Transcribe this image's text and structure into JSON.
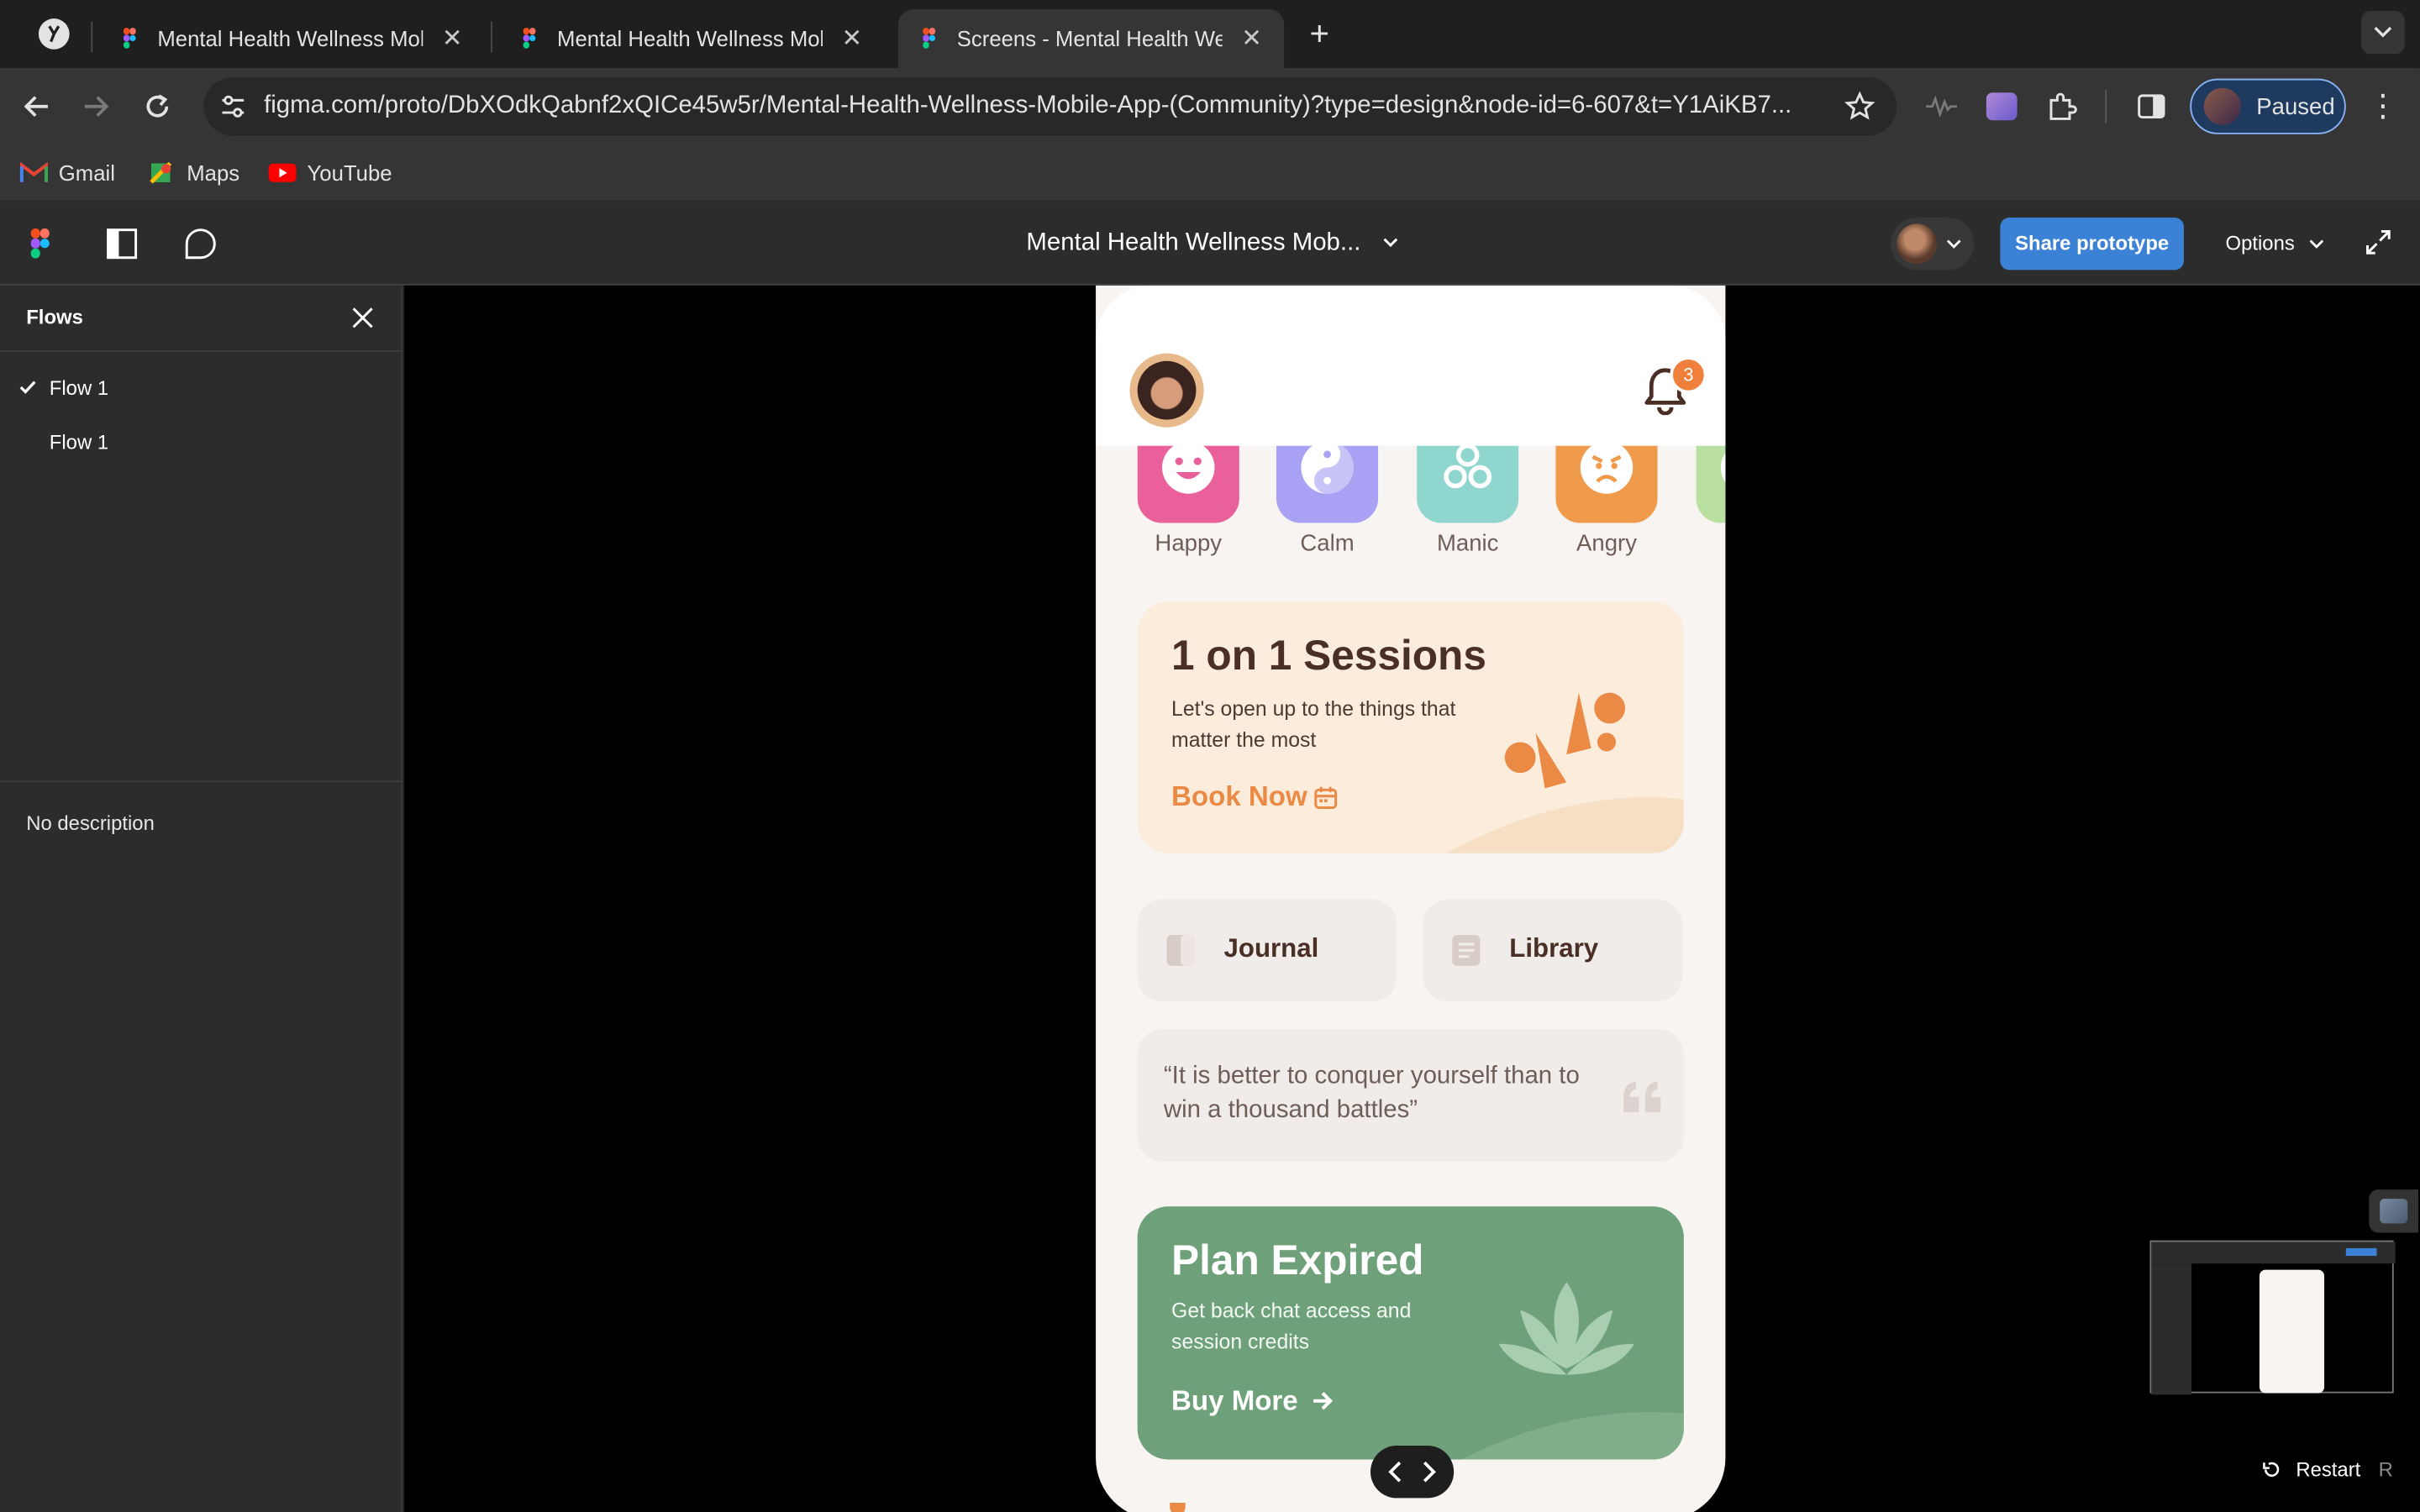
{
  "browser": {
    "tabs": [
      {
        "title": "Mental Health Wellness Mobile App (Community)",
        "active": false
      },
      {
        "title": "Mental Health Wellness Mobile App (Community)",
        "active": false
      },
      {
        "title": "Screens - Mental Health Wellness",
        "active": true
      }
    ],
    "url": "figma.com/proto/DbXOdkQabnf2xQICe45w5r/Mental-Health-Wellness-Mobile-App-(Community)?type=design&node-id=6-607&t=Y1AiKB7...",
    "profile_label": "Paused",
    "bookmarks": [
      "Gmail",
      "Maps",
      "YouTube"
    ]
  },
  "figma": {
    "file_title": "Mental Health Wellness Mob...",
    "share_label": "Share prototype",
    "options_label": "Options",
    "restart_label": "Restart",
    "restart_shortcut": "R"
  },
  "sidebar": {
    "title": "Flows",
    "flows": [
      {
        "label": "Flow 1",
        "selected": true
      },
      {
        "label": "Flow 1",
        "selected": false
      }
    ],
    "description": "No description"
  },
  "app": {
    "notification_count": "3",
    "moods": [
      {
        "label": "Happy",
        "color": "#e9609a",
        "icon": "smile-icon"
      },
      {
        "label": "Calm",
        "color": "#a9a2f4",
        "icon": "yin-yang-icon"
      },
      {
        "label": "Manic",
        "color": "#8fd6cf",
        "icon": "triskelion-icon"
      },
      {
        "label": "Angry",
        "color": "#f09a4c",
        "icon": "angry-face-icon"
      },
      {
        "label": "",
        "color": "#b9e0a0",
        "icon": "partial-mood-icon"
      }
    ],
    "sessions": {
      "title": "1 on 1 Sessions",
      "subtitle": "Let's open up to the things that matter the most",
      "cta": "Book Now"
    },
    "tiles": [
      {
        "label": "Journal"
      },
      {
        "label": "Library"
      }
    ],
    "quote": "“It is better to conquer yourself than to win a thousand battles”",
    "plan": {
      "title": "Plan Expired",
      "subtitle": "Get back chat access and session credits",
      "cta": "Buy More"
    }
  },
  "colors": {
    "accent": "#ea8a45",
    "plan_green": "#6ea07a",
    "share_blue": "#3b82d6",
    "text_dark": "#4a2f25"
  }
}
